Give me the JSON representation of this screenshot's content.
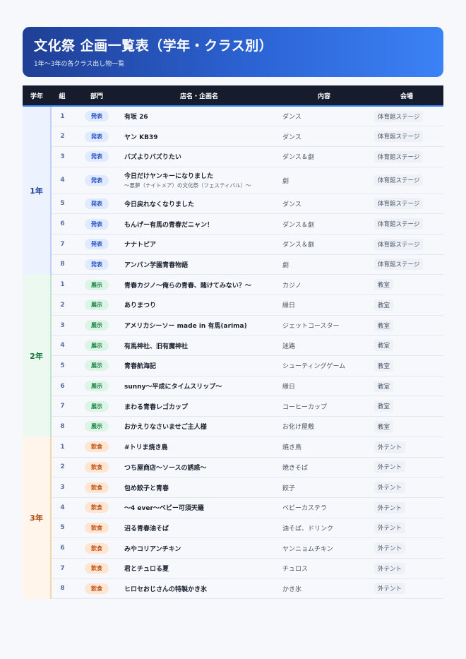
{
  "header": {
    "title": "文化祭 企画一覧表（学年・クラス別）",
    "subtitle": "1年〜3年の各クラス出し物一覧"
  },
  "columns": [
    "学年",
    "組",
    "部門",
    "店名・企画名",
    "内容",
    "会場"
  ],
  "years": [
    {
      "label": "1年",
      "rows": [
        {
          "num": "1",
          "dept": "発表",
          "name": "有坂 26",
          "content": "ダンス",
          "venue": "体育館ステージ"
        },
        {
          "num": "2",
          "dept": "発表",
          "name": "ヤン KB39",
          "content": "ダンス",
          "venue": "体育館ステージ"
        },
        {
          "num": "3",
          "dept": "発表",
          "name": "バズよりバズりたい",
          "content": "ダンス＆劇",
          "venue": "体育館ステージ"
        },
        {
          "num": "4",
          "dept": "発表",
          "name": "今日だけヤンキーになりました",
          "subname": "〜悪夢（ナイトメア）の文化祭（フェスティバル）〜",
          "content": "劇",
          "venue": "体育館ステージ"
        },
        {
          "num": "5",
          "dept": "発表",
          "name": "今日戻れなくなりました",
          "content": "ダンス",
          "venue": "体育館ステージ"
        },
        {
          "num": "6",
          "dept": "発表",
          "name": "もんげー有馬の青春だニャン！",
          "content": "ダンス＆劇",
          "venue": "体育館ステージ"
        },
        {
          "num": "7",
          "dept": "発表",
          "name": "ナナトピア",
          "content": "ダンス＆劇",
          "venue": "体育館ステージ"
        },
        {
          "num": "8",
          "dept": "発表",
          "name": "アンパン学園青春物語",
          "content": "劇",
          "venue": "体育館ステージ"
        }
      ]
    },
    {
      "label": "2年",
      "rows": [
        {
          "num": "1",
          "dept": "展示",
          "name": "青春カジノ〜俺らの青春、賭けてみない？〜",
          "content": "カジノ",
          "venue": "教室"
        },
        {
          "num": "2",
          "dept": "展示",
          "name": "ありまつり",
          "content": "縁日",
          "venue": "教室"
        },
        {
          "num": "3",
          "dept": "展示",
          "name": "アメリカシーソー made in 有馬(arima)",
          "content": "ジェットコースター",
          "venue": "教室"
        },
        {
          "num": "4",
          "dept": "展示",
          "name": "有馬神社、旧有魔神社",
          "content": "迷路",
          "venue": "教室"
        },
        {
          "num": "5",
          "dept": "展示",
          "name": "青春航海記",
          "content": "シューティングゲーム",
          "venue": "教室"
        },
        {
          "num": "6",
          "dept": "展示",
          "name": "sunny〜平成にタイムスリップ〜",
          "content": "縁日",
          "venue": "教室"
        },
        {
          "num": "7",
          "dept": "展示",
          "name": "まわる青春レゴカップ",
          "content": "コーヒーカップ",
          "venue": "教室"
        },
        {
          "num": "8",
          "dept": "展示",
          "name": "おかえりなさいませご主人様",
          "content": "お化け屋敷",
          "venue": "教室"
        }
      ]
    },
    {
      "label": "3年",
      "rows": [
        {
          "num": "1",
          "dept": "飲食",
          "name": "#トリま焼き鳥",
          "content": "焼き鳥",
          "venue": "外テント"
        },
        {
          "num": "2",
          "dept": "飲食",
          "name": "つち屋商店〜ソースの誘惑〜",
          "content": "焼きそば",
          "venue": "外テント"
        },
        {
          "num": "3",
          "dept": "飲食",
          "name": "包め餃子と青春",
          "content": "餃子",
          "venue": "外テント"
        },
        {
          "num": "4",
          "dept": "飲食",
          "name": "〜4 ever〜ベビー可須天羅",
          "content": "ベビーカステラ",
          "venue": "外テント"
        },
        {
          "num": "5",
          "dept": "飲食",
          "name": "沼る青春油そば",
          "content": "油そば、ドリンク",
          "venue": "外テント"
        },
        {
          "num": "6",
          "dept": "飲食",
          "name": "みやコリアンチキン",
          "content": "ヤンニョムチキン",
          "venue": "外テント"
        },
        {
          "num": "7",
          "dept": "飲食",
          "name": "君とチュロる夏",
          "content": "チュロス",
          "venue": "外テント"
        },
        {
          "num": "8",
          "dept": "飲食",
          "name": "ヒロセおじさんの特製かき氷",
          "content": "かき氷",
          "venue": "外テント"
        }
      ]
    }
  ]
}
